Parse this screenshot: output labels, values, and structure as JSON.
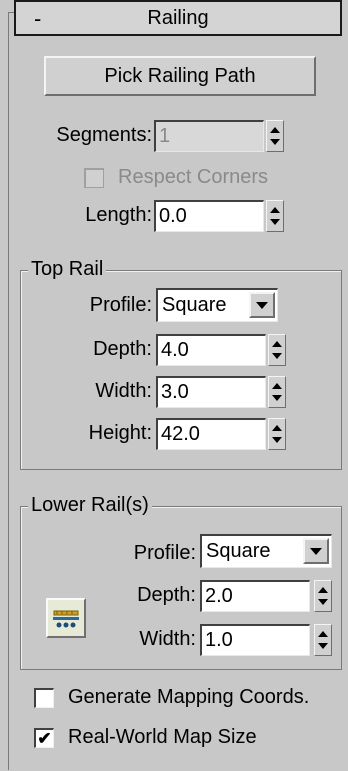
{
  "rollout": {
    "collapse_symbol": "-",
    "title": "Railing"
  },
  "pick_button": "Pick Railing Path",
  "segments": {
    "label": "Segments:",
    "value": "1"
  },
  "respect_corners": {
    "label": "Respect Corners",
    "checked": false
  },
  "length": {
    "label": "Length:",
    "value": "0.0"
  },
  "top_rail": {
    "title": "Top Rail",
    "profile": {
      "label": "Profile:",
      "value": "Square"
    },
    "depth": {
      "label": "Depth:",
      "value": "4.0"
    },
    "width": {
      "label": "Width:",
      "value": "3.0"
    },
    "height": {
      "label": "Height:",
      "value": "42.0"
    }
  },
  "lower_rails": {
    "title": "Lower Rail(s)",
    "icon": "lower-rail-spacing-icon",
    "profile": {
      "label": "Profile:",
      "value": "Square"
    },
    "depth": {
      "label": "Depth:",
      "value": "2.0"
    },
    "width": {
      "label": "Width:",
      "value": "1.0"
    }
  },
  "generate_mapping": {
    "label": "Generate Mapping Coords.",
    "checked": false
  },
  "real_world_map": {
    "label": "Real-World Map Size",
    "checked": true,
    "check_glyph": "✔"
  }
}
